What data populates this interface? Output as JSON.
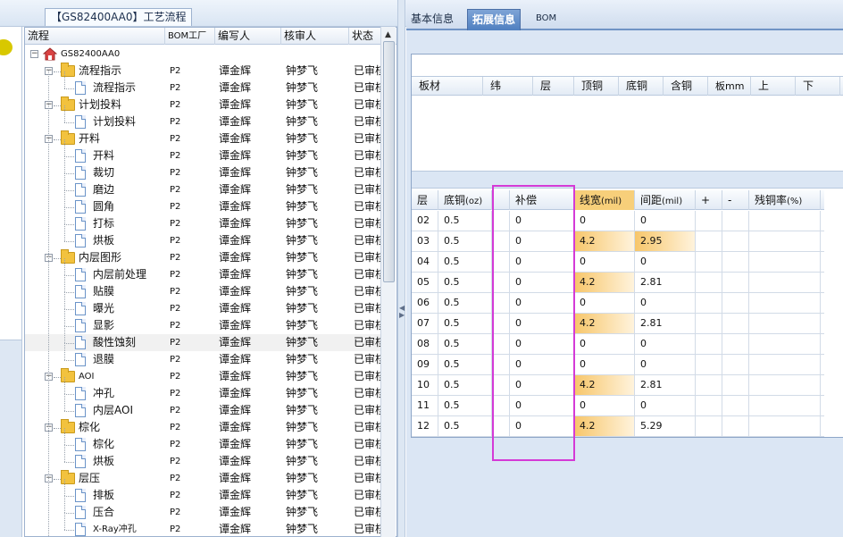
{
  "window": {
    "tab_title": "【GS82400AA0】工艺流程"
  },
  "tree": {
    "columns": [
      "流程",
      "BOM工厂",
      "编写人",
      "核审人",
      "状态"
    ],
    "rows": [
      {
        "label": "GS82400AA0",
        "type": "root",
        "level": 0,
        "bom": "",
        "writer": "",
        "reviewer": "",
        "status": ""
      },
      {
        "label": "流程指示",
        "type": "folder",
        "level": 1,
        "bom": "P2",
        "writer": "谭金辉",
        "reviewer": "钟梦飞",
        "status": "已审核"
      },
      {
        "label": "流程指示",
        "type": "doc",
        "level": 2,
        "bom": "P2",
        "writer": "谭金辉",
        "reviewer": "钟梦飞",
        "status": "已审核"
      },
      {
        "label": "计划投料",
        "type": "folder",
        "level": 1,
        "bom": "P2",
        "writer": "谭金辉",
        "reviewer": "钟梦飞",
        "status": "已审核"
      },
      {
        "label": "计划投料",
        "type": "doc",
        "level": 2,
        "bom": "P2",
        "writer": "谭金辉",
        "reviewer": "钟梦飞",
        "status": "已审核"
      },
      {
        "label": "开料",
        "type": "folder",
        "level": 1,
        "bom": "P2",
        "writer": "谭金辉",
        "reviewer": "钟梦飞",
        "status": "已审核"
      },
      {
        "label": "开料",
        "type": "doc",
        "level": 2,
        "bom": "P2",
        "writer": "谭金辉",
        "reviewer": "钟梦飞",
        "status": "已审核"
      },
      {
        "label": "裁切",
        "type": "doc",
        "level": 2,
        "bom": "P2",
        "writer": "谭金辉",
        "reviewer": "钟梦飞",
        "status": "已审核"
      },
      {
        "label": "磨边",
        "type": "doc",
        "level": 2,
        "bom": "P2",
        "writer": "谭金辉",
        "reviewer": "钟梦飞",
        "status": "已审核"
      },
      {
        "label": "圆角",
        "type": "doc",
        "level": 2,
        "bom": "P2",
        "writer": "谭金辉",
        "reviewer": "钟梦飞",
        "status": "已审核"
      },
      {
        "label": "打标",
        "type": "doc",
        "level": 2,
        "bom": "P2",
        "writer": "谭金辉",
        "reviewer": "钟梦飞",
        "status": "已审核"
      },
      {
        "label": "烘板",
        "type": "doc",
        "level": 2,
        "bom": "P2",
        "writer": "谭金辉",
        "reviewer": "钟梦飞",
        "status": "已审核"
      },
      {
        "label": "内层图形",
        "type": "folder",
        "level": 1,
        "bom": "P2",
        "writer": "谭金辉",
        "reviewer": "钟梦飞",
        "status": "已审核"
      },
      {
        "label": "内层前处理",
        "type": "doc",
        "level": 2,
        "bom": "P2",
        "writer": "谭金辉",
        "reviewer": "钟梦飞",
        "status": "已审核"
      },
      {
        "label": "贴膜",
        "type": "doc",
        "level": 2,
        "bom": "P2",
        "writer": "谭金辉",
        "reviewer": "钟梦飞",
        "status": "已审核"
      },
      {
        "label": "曝光",
        "type": "doc",
        "level": 2,
        "bom": "P2",
        "writer": "谭金辉",
        "reviewer": "钟梦飞",
        "status": "已审核"
      },
      {
        "label": "显影",
        "type": "doc",
        "level": 2,
        "bom": "P2",
        "writer": "谭金辉",
        "reviewer": "钟梦飞",
        "status": "已审核"
      },
      {
        "label": "酸性蚀刻",
        "type": "doc",
        "level": 2,
        "bom": "P2",
        "writer": "谭金辉",
        "reviewer": "钟梦飞",
        "status": "已审核",
        "selected": true
      },
      {
        "label": "退膜",
        "type": "doc",
        "level": 2,
        "bom": "P2",
        "writer": "谭金辉",
        "reviewer": "钟梦飞",
        "status": "已审核"
      },
      {
        "label": "AOI",
        "type": "folder",
        "level": 1,
        "bom": "P2",
        "writer": "谭金辉",
        "reviewer": "钟梦飞",
        "status": "已审核"
      },
      {
        "label": "冲孔",
        "type": "doc",
        "level": 2,
        "bom": "P2",
        "writer": "谭金辉",
        "reviewer": "钟梦飞",
        "status": "已审核"
      },
      {
        "label": "内层AOI",
        "type": "doc",
        "level": 2,
        "bom": "P2",
        "writer": "谭金辉",
        "reviewer": "钟梦飞",
        "status": "已审核"
      },
      {
        "label": "棕化",
        "type": "folder",
        "level": 1,
        "bom": "P2",
        "writer": "谭金辉",
        "reviewer": "钟梦飞",
        "status": "已审核"
      },
      {
        "label": "棕化",
        "type": "doc",
        "level": 2,
        "bom": "P2",
        "writer": "谭金辉",
        "reviewer": "钟梦飞",
        "status": "已审核"
      },
      {
        "label": "烘板",
        "type": "doc",
        "level": 2,
        "bom": "P2",
        "writer": "谭金辉",
        "reviewer": "钟梦飞",
        "status": "已审核"
      },
      {
        "label": "层压",
        "type": "folder",
        "level": 1,
        "bom": "P2",
        "writer": "谭金辉",
        "reviewer": "钟梦飞",
        "status": "已审核"
      },
      {
        "label": "排板",
        "type": "doc",
        "level": 2,
        "bom": "P2",
        "writer": "谭金辉",
        "reviewer": "钟梦飞",
        "status": "已审核"
      },
      {
        "label": "压合",
        "type": "doc",
        "level": 2,
        "bom": "P2",
        "writer": "谭金辉",
        "reviewer": "钟梦飞",
        "status": "已审核"
      },
      {
        "label": "X-Ray冲孔",
        "type": "doc",
        "level": 2,
        "bom": "P2",
        "writer": "谭金辉",
        "reviewer": "钟梦飞",
        "status": "已审核"
      }
    ]
  },
  "right": {
    "tabs": [
      "基本信息",
      "拓展信息",
      "BOM"
    ],
    "active_tab": 1,
    "grid1": {
      "columns": [
        "板材",
        "纬",
        "层",
        "顶铜",
        "底铜",
        "含铜",
        "板mm",
        "上",
        "下"
      ]
    },
    "grid2": {
      "columns": [
        {
          "label": "层",
          "unit": ""
        },
        {
          "label": "底铜",
          "unit": "(oz)"
        },
        {
          "label": "",
          "unit": ""
        },
        {
          "label": "补偿",
          "unit": ""
        },
        {
          "label": "线宽",
          "unit": "(mil)"
        },
        {
          "label": "间距",
          "unit": "(mil)"
        },
        {
          "label": "+",
          "unit": ""
        },
        {
          "label": "-",
          "unit": ""
        },
        {
          "label": "残铜率",
          "unit": "(%)"
        }
      ],
      "rows": [
        [
          "02",
          "0.5",
          "",
          "0",
          "0",
          "0",
          "",
          "",
          ""
        ],
        [
          "03",
          "0.5",
          "",
          "0",
          "4.2",
          "2.95",
          "",
          "",
          ""
        ],
        [
          "04",
          "0.5",
          "",
          "0",
          "0",
          "0",
          "",
          "",
          ""
        ],
        [
          "05",
          "0.5",
          "",
          "0",
          "4.2",
          "2.81",
          "",
          "",
          ""
        ],
        [
          "06",
          "0.5",
          "",
          "0",
          "0",
          "0",
          "",
          "",
          ""
        ],
        [
          "07",
          "0.5",
          "",
          "0",
          "4.2",
          "2.81",
          "",
          "",
          ""
        ],
        [
          "08",
          "0.5",
          "",
          "0",
          "0",
          "0",
          "",
          "",
          ""
        ],
        [
          "09",
          "0.5",
          "",
          "0",
          "0",
          "0",
          "",
          "",
          ""
        ],
        [
          "10",
          "0.5",
          "",
          "0",
          "4.2",
          "2.81",
          "",
          "",
          ""
        ],
        [
          "11",
          "0.5",
          "",
          "0",
          "0",
          "0",
          "",
          "",
          ""
        ],
        [
          "12",
          "0.5",
          "",
          "0",
          "4.2",
          "5.29",
          "",
          "",
          ""
        ]
      ]
    }
  },
  "colors": {
    "accent": "#4f7fc0",
    "highlight": "#f7cf7a",
    "annotation": "#d43ad6"
  }
}
